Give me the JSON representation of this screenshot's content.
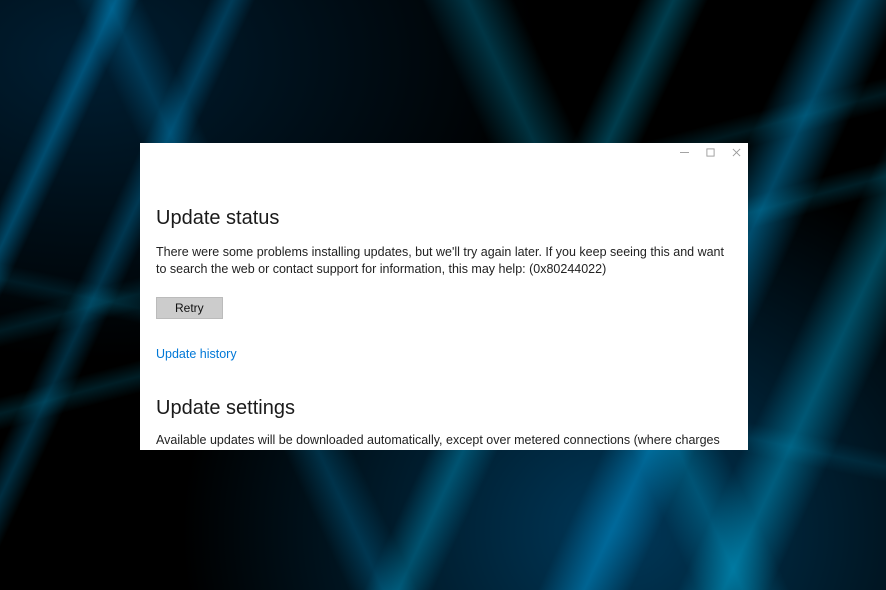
{
  "update_status": {
    "heading": "Update status",
    "message": "There were some problems installing updates, but we'll try again later. If you keep seeing this and want to search the web or contact support for information, this may help: (0x80244022)",
    "retry_label": "Retry",
    "history_link": "Update history"
  },
  "update_settings": {
    "heading": "Update settings",
    "description": "Available updates will be downloaded automatically, except over metered connections (where charges may apply). You'll be asked to install updates when they've been downloaded."
  }
}
